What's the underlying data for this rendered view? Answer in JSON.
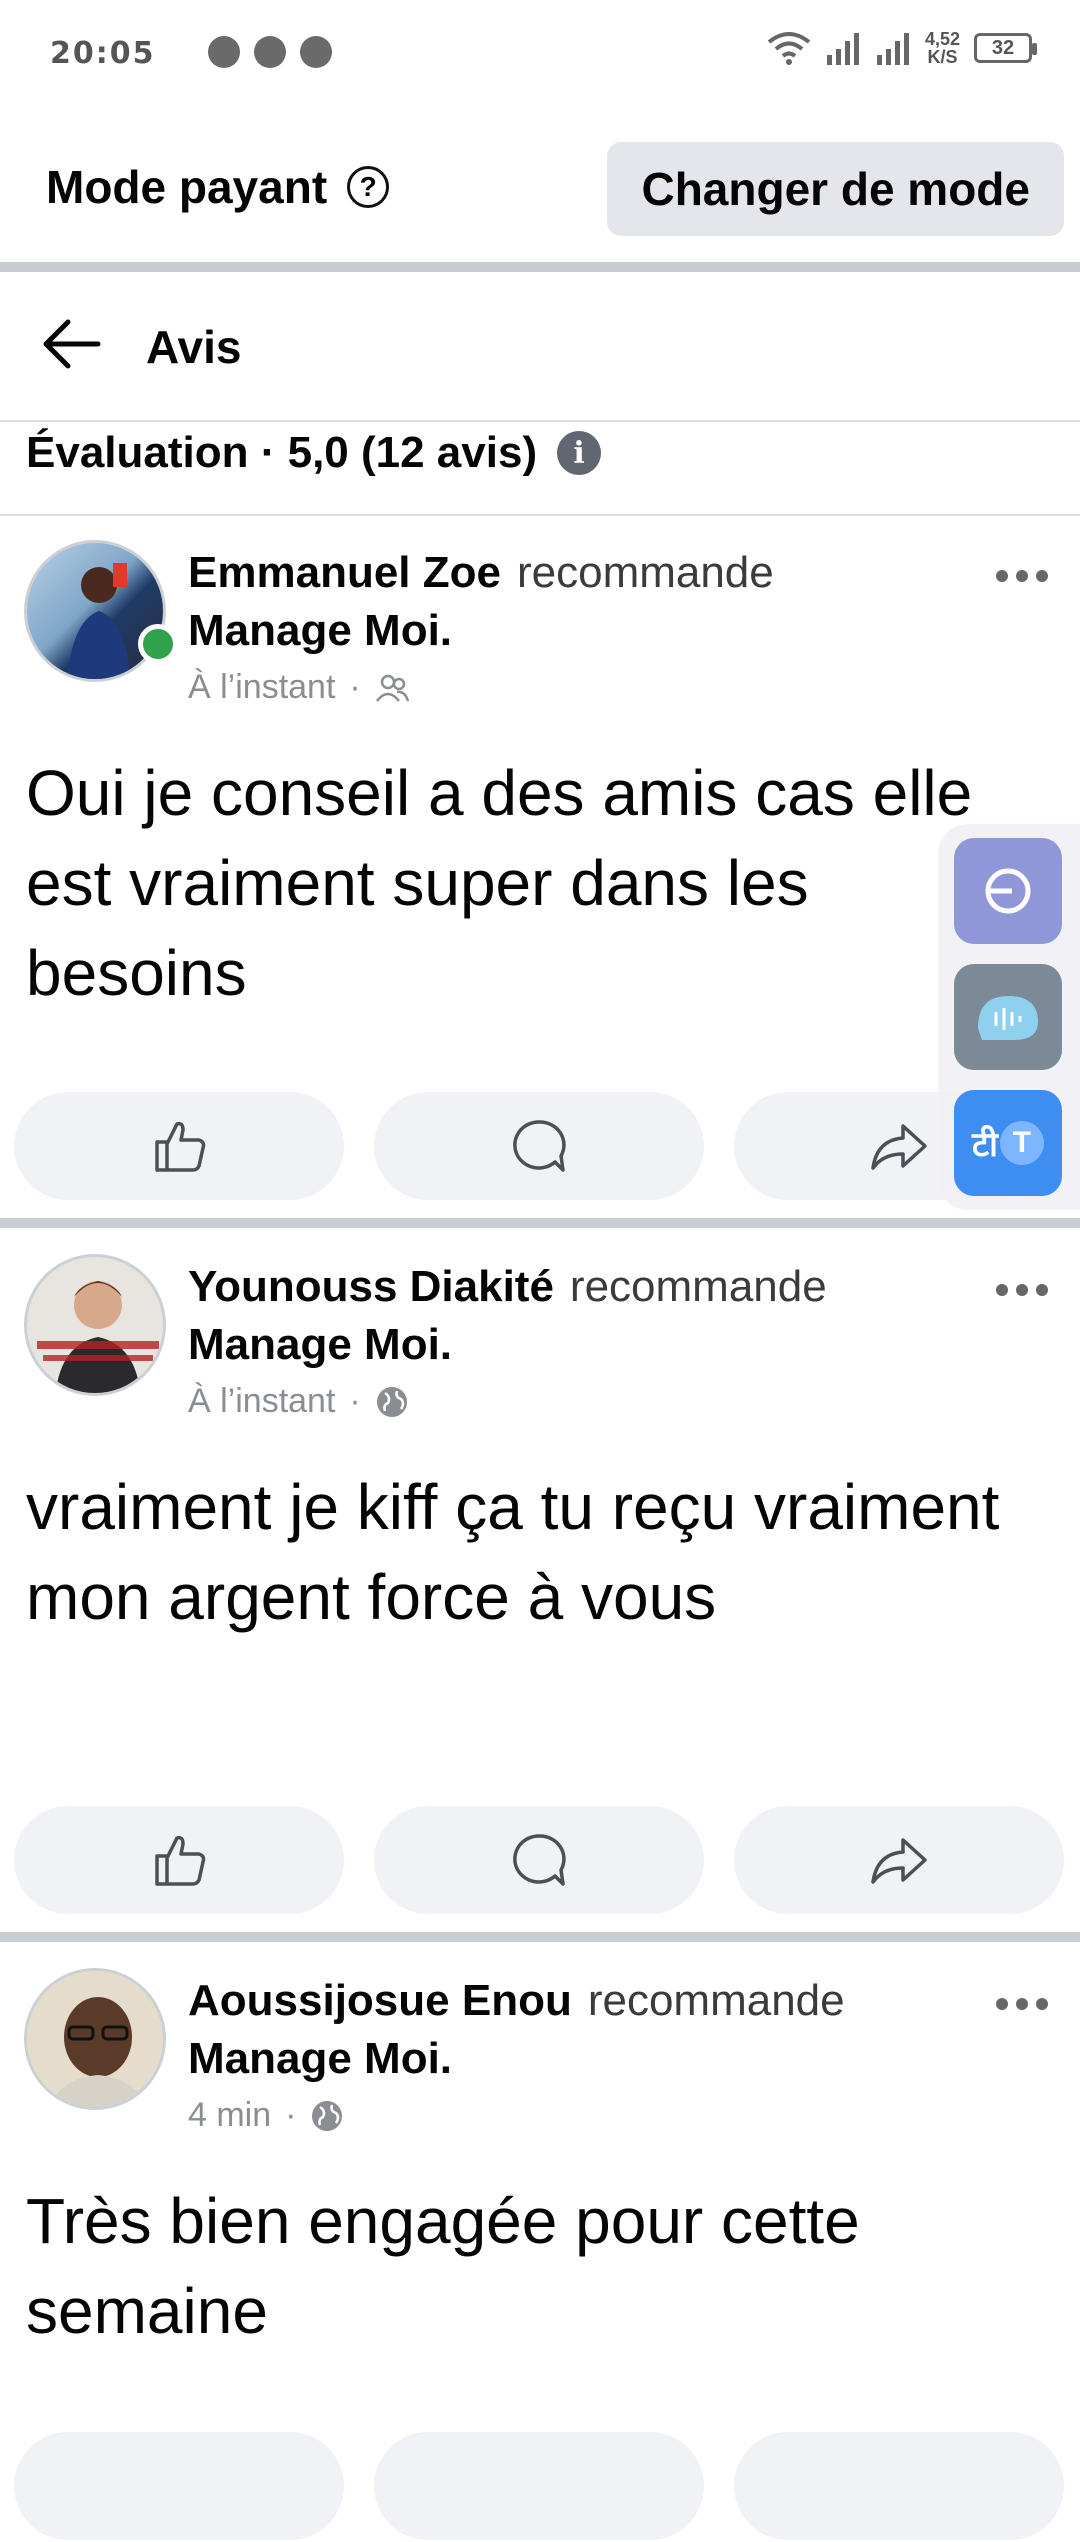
{
  "status_bar": {
    "time": "20:05",
    "net_speed": "4,52",
    "net_unit": "K/S",
    "battery": "32"
  },
  "mode_bar": {
    "label": "Mode payant",
    "help_glyph": "?",
    "switch_button": "Changer de mode"
  },
  "header": {
    "back_icon": "arrow-left-icon",
    "title": "Avis"
  },
  "rating": {
    "text": "Évaluation · 5,0 (12 avis)",
    "info_glyph": "i"
  },
  "reviews": [
    {
      "name": "Emmanuel Zoe",
      "verb": "recommande",
      "page": "Manage Moi",
      "time": "À l’instant",
      "audience_icon": "friends-icon",
      "online": true,
      "text": "Oui je conseil a des amis cas elle est vraiment super dans les besoins"
    },
    {
      "name": "Younouss Diakité",
      "verb": "recommande",
      "page": "Manage Moi",
      "time": "À l’instant",
      "audience_icon": "globe-icon",
      "online": false,
      "text": "vraiment je kiff ça tu reçu vraiment mon argent force à vous"
    },
    {
      "name": "Aoussijosue Enou",
      "verb": "recommande",
      "page": "Manage Moi",
      "time": "4 min",
      "audience_icon": "globe-icon",
      "online": false,
      "text": "Très bien engagée pour cette semaine"
    }
  ],
  "actions": [
    "like-icon",
    "comment-icon",
    "share-icon"
  ],
  "floating_tools": {
    "translate_glyphs": [
      "टी",
      "T"
    ]
  },
  "colors": {
    "online": "#31a24c",
    "button_bg": "#e4e6eb",
    "action_bg": "#f0f2f5",
    "divider": "#c9ccd1"
  }
}
